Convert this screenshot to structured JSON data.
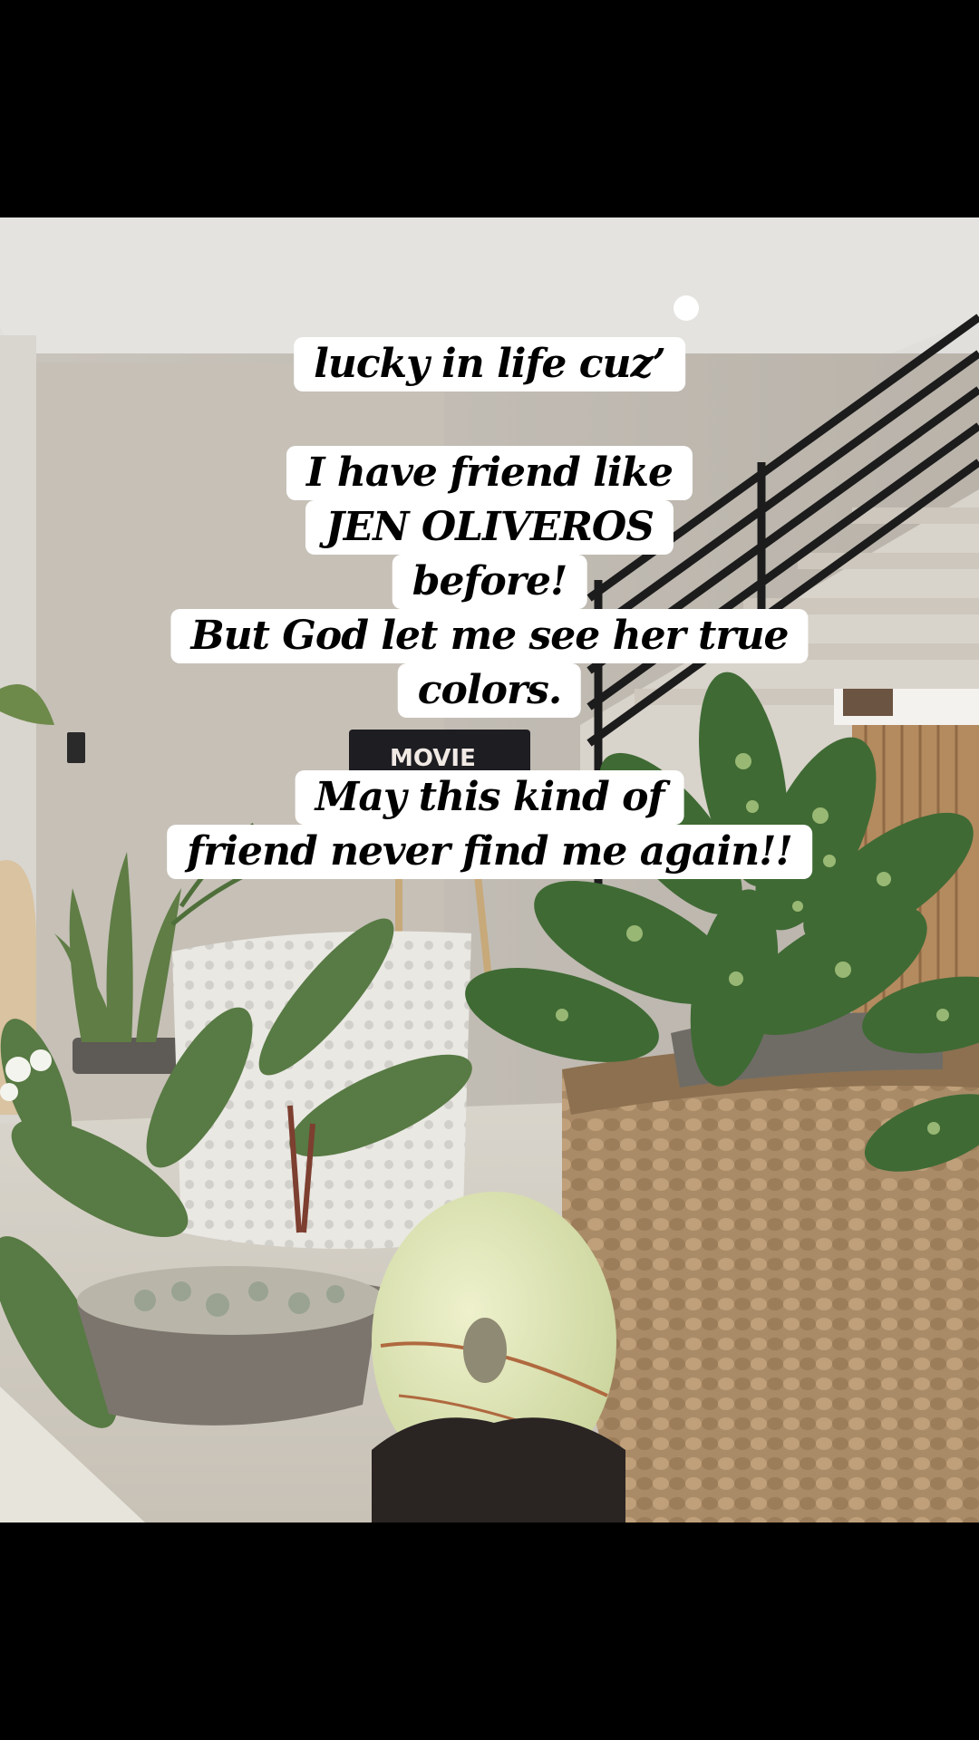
{
  "captions": {
    "line1": "lucky in life cuz’",
    "line2": "I have friend like",
    "line3": "JEN OLIVEROS",
    "line4": "before!",
    "line5": "But God let me see her true",
    "line6": "colors.",
    "line7": "May this kind of",
    "line8": "friend never find me again!!"
  },
  "scene": {
    "sign_text": "MOVIE"
  },
  "colors": {
    "caption_bg": "#ffffff",
    "caption_text": "#000000",
    "letterbox": "#000000"
  }
}
